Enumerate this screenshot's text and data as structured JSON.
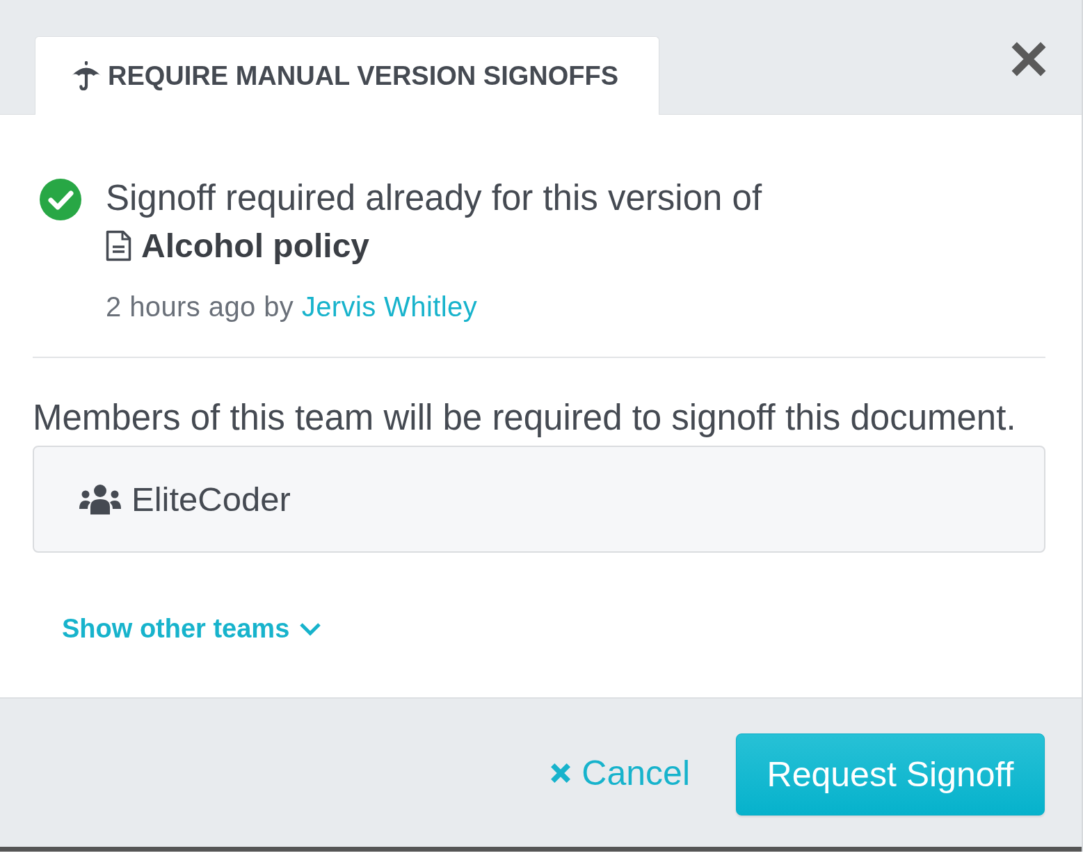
{
  "dialog": {
    "tabs": [
      {
        "label": "REQUIRE MANUAL VERSION SIGNOFFS",
        "selected": true
      }
    ]
  },
  "status": {
    "message": "Signoff required already for this version of",
    "document": "Alcohol policy",
    "meta": "2 hours ago by",
    "author": "Jervis Whitley"
  },
  "teams": {
    "prompt": "Members of this team will be required to signoff this document.",
    "items": [
      {
        "name": "EliteCoder"
      }
    ],
    "show_more": "Show other teams"
  },
  "footer": {
    "buttons": [
      {
        "kind": "link",
        "label": "Cancel"
      },
      {
        "kind": "primary",
        "label": "Request Signoff"
      }
    ]
  }
}
